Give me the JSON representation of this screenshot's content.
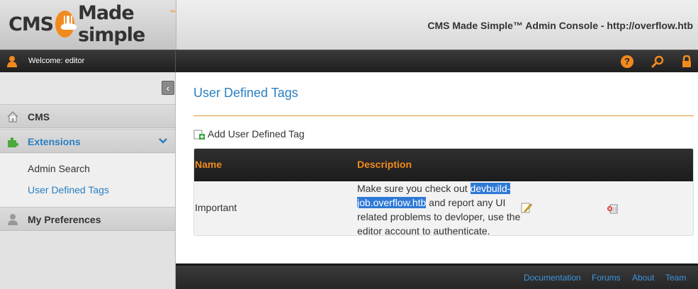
{
  "header": {
    "logo": {
      "word1": "CMS",
      "word2": "Made simple",
      "tm": "™"
    },
    "site_title": "CMS Made Simple™ Admin Console - http://overflow.htb"
  },
  "topbar": {
    "welcome": "Welcome: editor",
    "help_glyph": "?"
  },
  "sidebar": {
    "collapse_glyph": "‹",
    "items": [
      {
        "label": "CMS",
        "icon": "home-icon"
      },
      {
        "label": "Extensions",
        "icon": "puzzle-icon",
        "expanded": true
      },
      {
        "label": "My Preferences",
        "icon": "user-icon"
      }
    ],
    "submenu": [
      {
        "label": "Admin Search"
      },
      {
        "label": "User Defined Tags",
        "active": true
      }
    ]
  },
  "main": {
    "page_title": "User Defined Tags",
    "add_link": "Add User Defined Tag",
    "table": {
      "headers": [
        "Name",
        "Description"
      ],
      "rows": [
        {
          "name": "Important",
          "desc_before": "Make sure you check out ",
          "desc_highlight": "devbuild-job.overflow.htb",
          "desc_after": " and report any UI related problems to devloper, use the editor account to authenticate."
        }
      ]
    }
  },
  "footer": {
    "links": [
      "Documentation",
      "Forums",
      "About",
      "Team"
    ]
  },
  "colors": {
    "accent_orange": "#f18a1e",
    "link_blue": "#2a7fc1",
    "selection_blue": "#2f79d6"
  }
}
